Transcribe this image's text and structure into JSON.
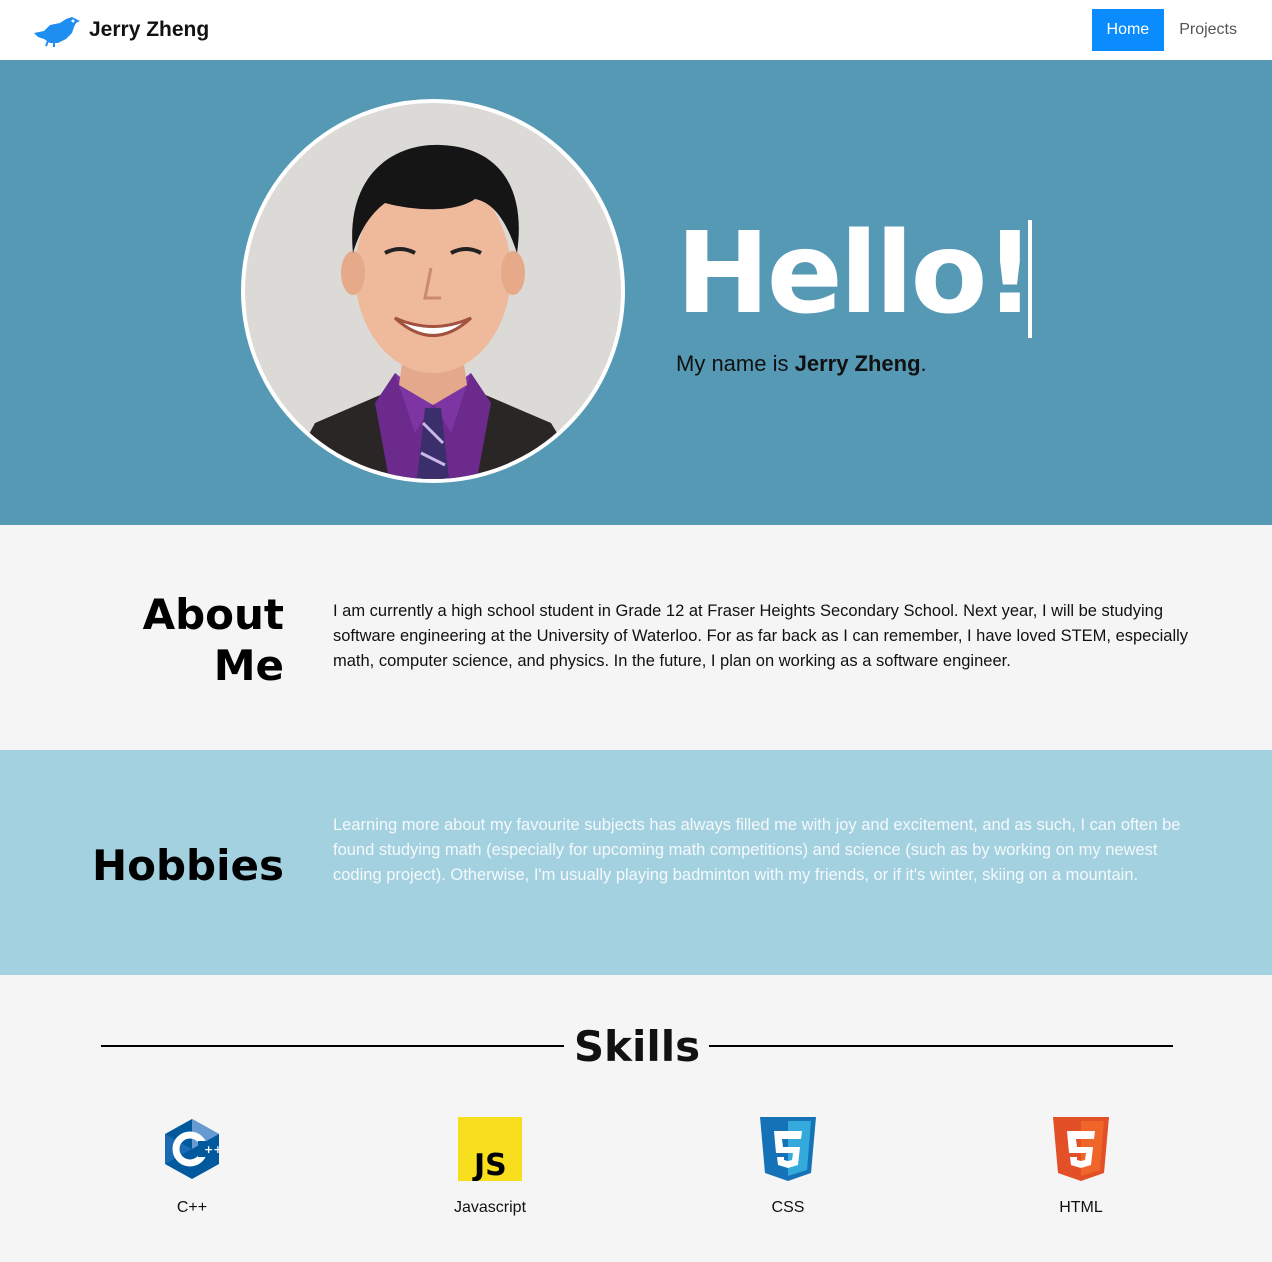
{
  "navbar": {
    "brand_name": "Jerry Zheng",
    "brand_icon": "bird-icon",
    "links": [
      {
        "label": "Home",
        "active": true
      },
      {
        "label": "Projects",
        "active": false
      }
    ],
    "active_color": "#0a8cff"
  },
  "hero": {
    "background": "#5599b5",
    "greeting": "Hello!",
    "intro_prefix": "My name is ",
    "intro_name": "Jerry Zheng",
    "intro_suffix": "."
  },
  "about": {
    "title_line1": "About",
    "title_line2": "Me",
    "text": "I am currently a high school student in Grade 12 at Fraser Heights Secondary School. Next year, I will be studying software engineering at the University of Waterloo. For as far back as I can remember, I have loved STEM, especially math, computer science, and physics. In the future, I plan on working as a software engineer."
  },
  "hobbies": {
    "title": "Hobbies",
    "background": "#a4d1e0",
    "text": "Learning more about my favourite subjects has always filled me with joy and excitement, and as such, I can often be found studying math (especially for upcoming math competitions) and science (such as by working on my newest coding project). Otherwise, I'm usually playing badminton with my friends, or if it's winter, skiing on a mountain."
  },
  "skills": {
    "title": "Skills",
    "items": [
      {
        "label": "C++",
        "icon": "cpp-icon"
      },
      {
        "label": "Javascript",
        "icon": "javascript-icon"
      },
      {
        "label": "CSS",
        "icon": "css3-icon"
      },
      {
        "label": "HTML",
        "icon": "html5-icon"
      }
    ]
  }
}
